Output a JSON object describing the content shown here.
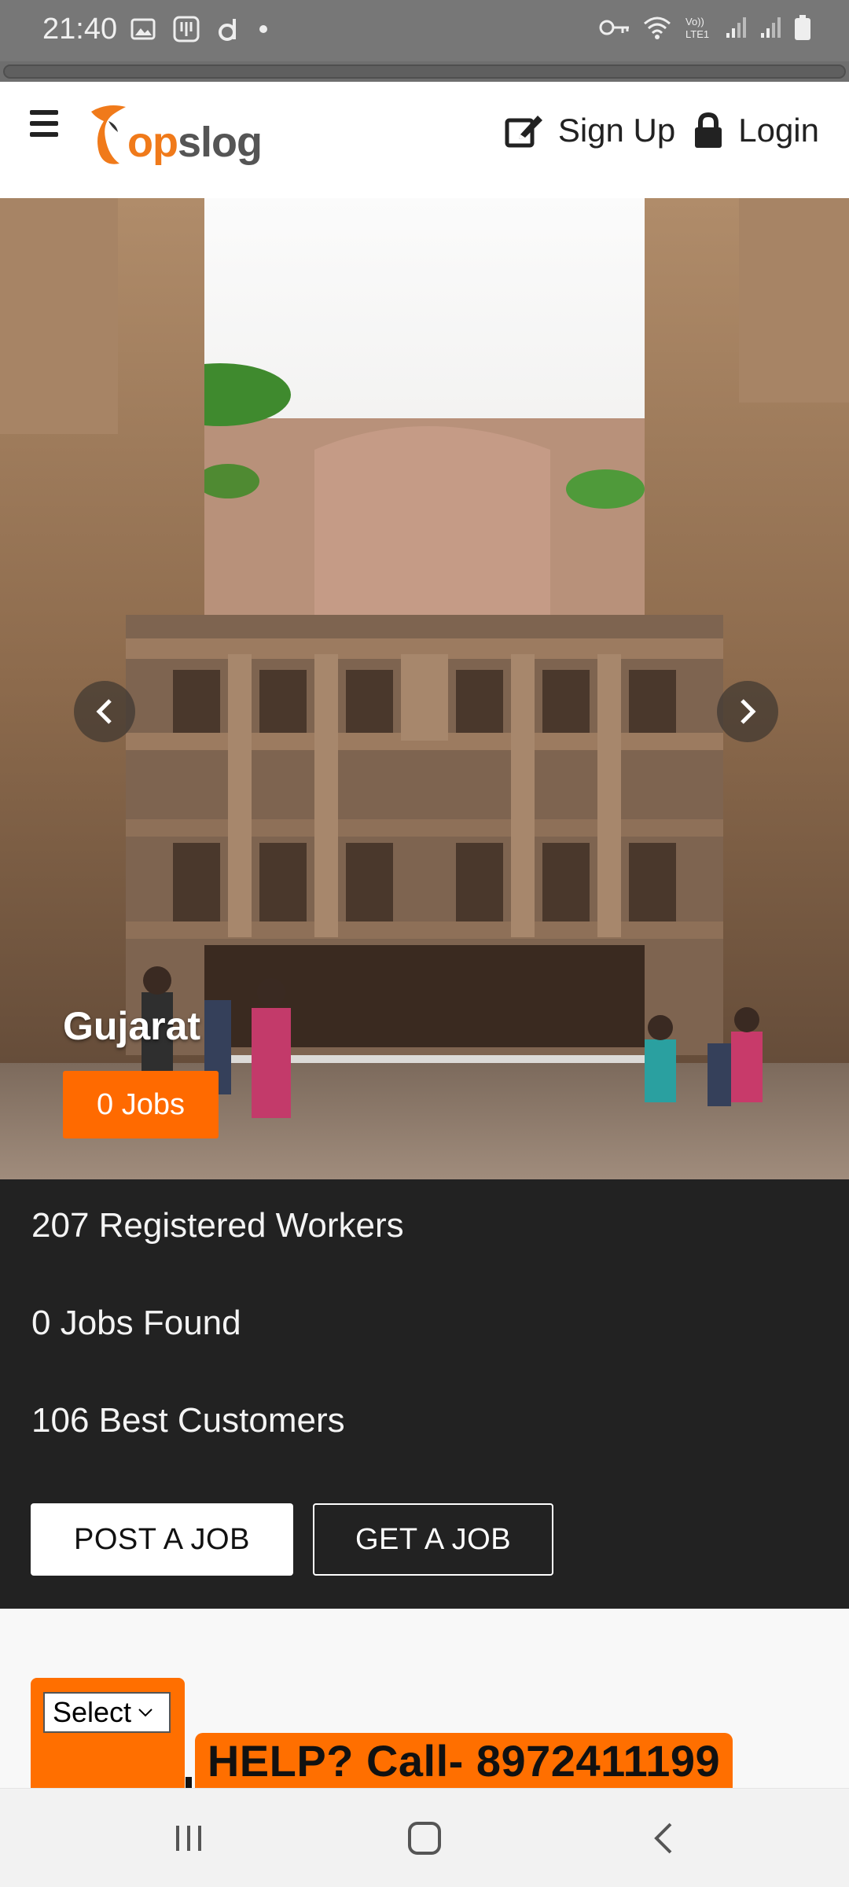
{
  "status_bar": {
    "time": "21:40",
    "left_icons": [
      "image-icon",
      "voicemail-icon",
      "d-app-icon",
      "dot-icon"
    ],
    "right_icons": [
      "key-icon",
      "wifi-icon",
      "volte-icon",
      "signal-icon",
      "signal-icon",
      "battery-icon"
    ],
    "volte_text": "Vo))\nLTE1"
  },
  "header": {
    "logo_text_op": "op",
    "logo_text_slog": "slog",
    "signup_label": "Sign Up",
    "login_label": "Login",
    "accent": "#ff6a00"
  },
  "hero": {
    "title": "Gujarat",
    "jobs_badge": "0 Jobs"
  },
  "stats": {
    "registered_workers": "207 Registered Workers",
    "jobs_found": "0 Jobs Found",
    "best_customers": "106 Best Customers",
    "post_job_label": "POST A JOB",
    "get_job_label": "GET A JOB"
  },
  "footer": {
    "select_value": "Select",
    "help_text": "HELP? Call- 8972411199"
  },
  "colors": {
    "status_bar": "#777777",
    "stats_bg": "#222222",
    "orange": "#ff6f00"
  }
}
